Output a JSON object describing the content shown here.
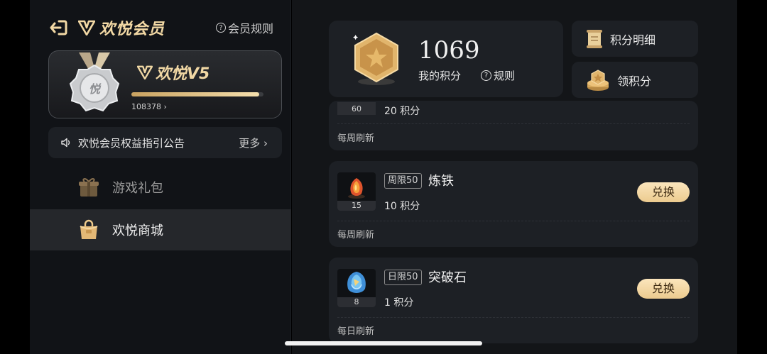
{
  "header": {
    "title": "欢悦会员",
    "rules_label": "会员规则"
  },
  "vip": {
    "level_label": "欢悦V5",
    "progress": 0.97,
    "exp_text": "108378 ›"
  },
  "notice": {
    "text": "欢悦会员权益指引公告",
    "more_label": "更多 ›"
  },
  "menu": [
    {
      "label": "游戏礼包",
      "active": false
    },
    {
      "label": "欢悦商城",
      "active": true
    }
  ],
  "points": {
    "value": "1069",
    "label": "我的积分",
    "rule_label": "规则"
  },
  "side_buttons": {
    "detail_label": "积分明细",
    "earn_label": "领积分"
  },
  "items": [
    {
      "count": "60",
      "cost": "20 积分",
      "refresh": "每周刷新"
    },
    {
      "count": "15",
      "tag": "周限50",
      "name": "炼铁",
      "cost": "10 积分",
      "refresh": "每周刷新",
      "button": "兑换"
    },
    {
      "count": "8",
      "tag": "日限50",
      "name": "突破石",
      "cost": "1 积分",
      "refresh": "每日刷新",
      "button": "兑换"
    }
  ],
  "colors": {
    "gold": "#f3d9a5",
    "button_bg": "#f5d8a3",
    "panel": "#1d2025"
  }
}
